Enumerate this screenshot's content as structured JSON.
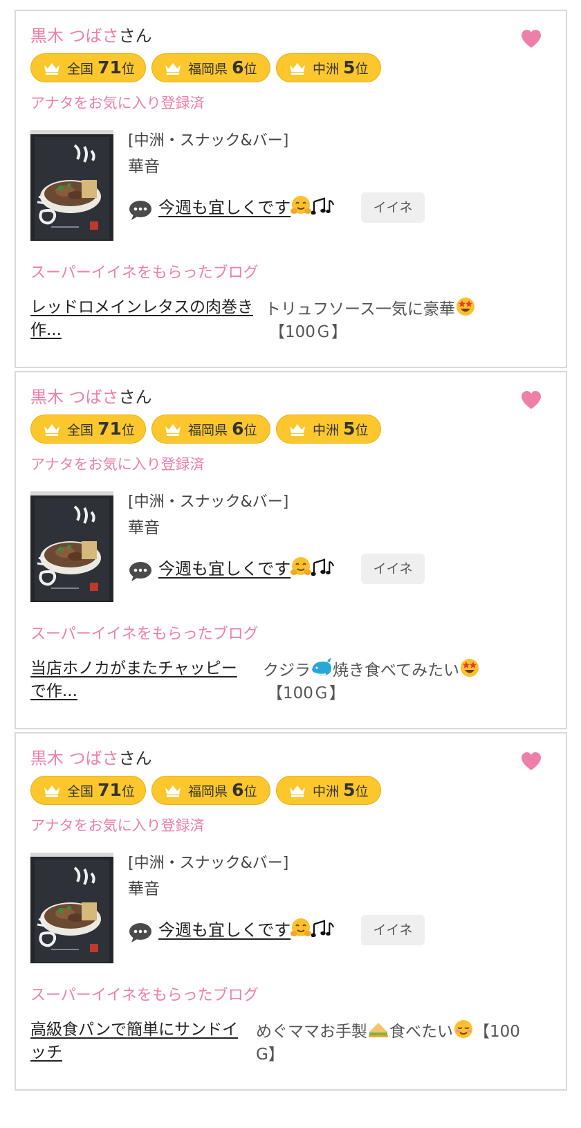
{
  "colors": {
    "accent_pink": "#ee7fa9",
    "badge_yellow": "#fbc72d",
    "like_button_bg": "#efefef"
  },
  "cards": [
    {
      "name": "黒木 つばさ",
      "honorific": "さん",
      "favorite_icon": "heart-icon",
      "badges": [
        {
          "region": "全国",
          "rank": "71",
          "unit": "位"
        },
        {
          "region": "福岡県",
          "rank": "6",
          "unit": "位"
        },
        {
          "region": "中洲",
          "rank": "5",
          "unit": "位"
        }
      ],
      "favorite_status": "アナタをお気に入り登録済",
      "shop_category": "[中洲・スナック&バー]",
      "shop_name": "華音",
      "message": "今週も宜しくです",
      "like_button": "イイネ",
      "blog_heading": "スーパーイイネをもらったブログ",
      "blog_title_line1": "レッドロメインレタスの肉巻き",
      "blog_title_line2": "作...",
      "blog_excerpt_line1": "トリュフソース一気に豪華",
      "blog_excerpt_line2": "【100Ｇ】"
    },
    {
      "name": "黒木 つばさ",
      "honorific": "さん",
      "favorite_icon": "heart-icon",
      "badges": [
        {
          "region": "全国",
          "rank": "71",
          "unit": "位"
        },
        {
          "region": "福岡県",
          "rank": "6",
          "unit": "位"
        },
        {
          "region": "中洲",
          "rank": "5",
          "unit": "位"
        }
      ],
      "favorite_status": "アナタをお気に入り登録済",
      "shop_category": "[中洲・スナック&バー]",
      "shop_name": "華音",
      "message": "今週も宜しくです",
      "like_button": "イイネ",
      "blog_heading": "スーパーイイネをもらったブログ",
      "blog_title_line1": "当店ホノカがまたチャッピー",
      "blog_title_line2": "で作...",
      "blog_excerpt_line1a": "クジラ",
      "blog_excerpt_line1b": "焼き食べてみたい",
      "blog_excerpt_line2": "【100Ｇ】"
    },
    {
      "name": "黒木 つばさ",
      "honorific": "さん",
      "favorite_icon": "heart-icon",
      "badges": [
        {
          "region": "全国",
          "rank": "71",
          "unit": "位"
        },
        {
          "region": "福岡県",
          "rank": "6",
          "unit": "位"
        },
        {
          "region": "中洲",
          "rank": "5",
          "unit": "位"
        }
      ],
      "favorite_status": "アナタをお気に入り登録済",
      "shop_category": "[中洲・スナック&バー]",
      "shop_name": "華音",
      "message": "今週も宜しくです",
      "like_button": "イイネ",
      "blog_heading": "スーパーイイネをもらったブログ",
      "blog_title_line1": "高級食パンで簡単にサンドイ",
      "blog_title_line2": "ッチ",
      "blog_excerpt_line1a": "めぐママお手製",
      "blog_excerpt_line1b": "食べたい",
      "blog_excerpt_line1c": "【100",
      "blog_excerpt_line2": "G】"
    }
  ]
}
